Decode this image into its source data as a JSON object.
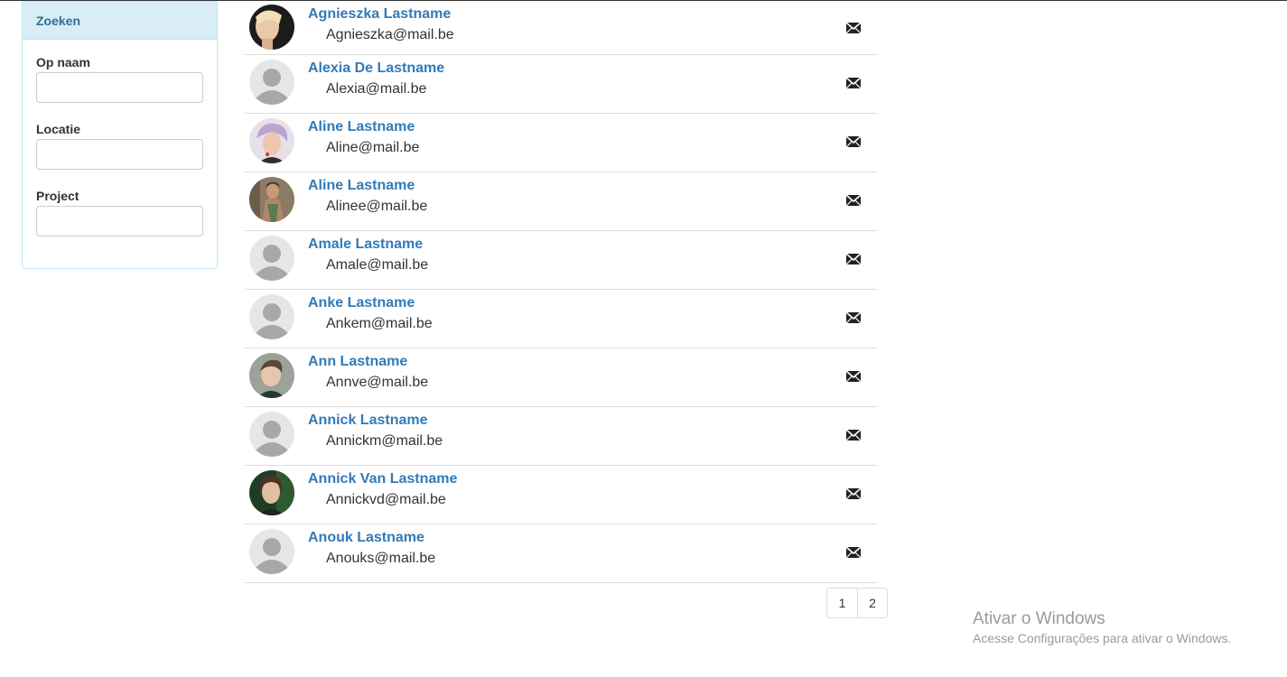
{
  "search_panel": {
    "heading": "Zoeken",
    "fields": [
      {
        "label": "Op naam",
        "value": "",
        "placeholder": ""
      },
      {
        "label": "Locatie",
        "value": "",
        "placeholder": ""
      },
      {
        "label": "Project",
        "value": "",
        "placeholder": ""
      }
    ]
  },
  "people": [
    {
      "name": "Agnieszka Lastname",
      "email": "Agnieszka@mail.be",
      "avatar": "photo"
    },
    {
      "name": "Alexia De Lastname",
      "email": "Alexia@mail.be",
      "avatar": "default"
    },
    {
      "name": "Aline Lastname",
      "email": "Aline@mail.be",
      "avatar": "photo"
    },
    {
      "name": "Aline Lastname",
      "email": "Alinee@mail.be",
      "avatar": "photo"
    },
    {
      "name": "Amale Lastname",
      "email": "Amale@mail.be",
      "avatar": "default"
    },
    {
      "name": "Anke Lastname",
      "email": "Ankem@mail.be",
      "avatar": "default"
    },
    {
      "name": "Ann Lastname",
      "email": "Annve@mail.be",
      "avatar": "photo"
    },
    {
      "name": "Annick Lastname",
      "email": "Annickm@mail.be",
      "avatar": "default"
    },
    {
      "name": "Annick Van Lastname",
      "email": "Annickvd@mail.be",
      "avatar": "photo"
    },
    {
      "name": "Anouk Lastname",
      "email": "Anouks@mail.be",
      "avatar": "default"
    }
  ],
  "pagination": {
    "pages": [
      "1",
      "2"
    ]
  },
  "watermark": {
    "title": "Ativar o Windows",
    "subtitle": "Acesse Configurações para ativar o Windows."
  },
  "icons": {
    "row_action": "envelope-icon",
    "default_avatar": "person-silhouette-icon"
  },
  "colors": {
    "link": "#337ab7",
    "panel_heading_bg": "#d9edf7",
    "panel_heading_text": "#31708f",
    "panel_border": "#bce8f1"
  }
}
